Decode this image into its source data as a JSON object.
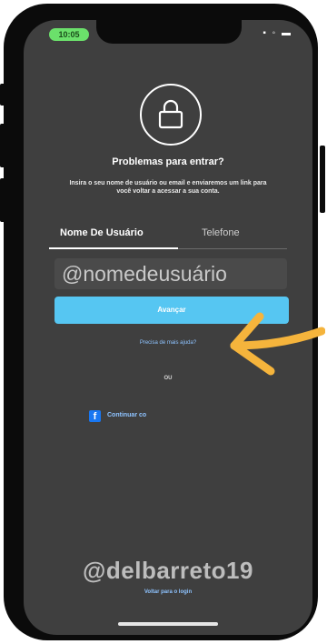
{
  "status_bar": {
    "time": "10:05",
    "icons": "▪ ◦ ▬"
  },
  "header": {
    "lock_icon": "lock-icon",
    "title": "Problemas para entrar?",
    "description": "Insira o seu nome de usuário ou email e enviaremos um link para você voltar a acessar a sua conta."
  },
  "tabs": [
    {
      "label": "Nome De Usuário",
      "active": true
    },
    {
      "label": "Telefone",
      "active": false
    }
  ],
  "form": {
    "username_value": "@nomedeusuário",
    "submit_label": "Avançar"
  },
  "links": {
    "help": "Precisa de mais ajuda?",
    "or": "OU",
    "facebook": "Continuar co",
    "back": "Voltar para o login"
  },
  "watermark": "@delbarreto19",
  "colors": {
    "screen_bg": "#3f3f3f",
    "primary_button": "#56c6f2",
    "link": "#8ec3ff",
    "facebook": "#1877f2",
    "arrow": "#f5b43c"
  }
}
